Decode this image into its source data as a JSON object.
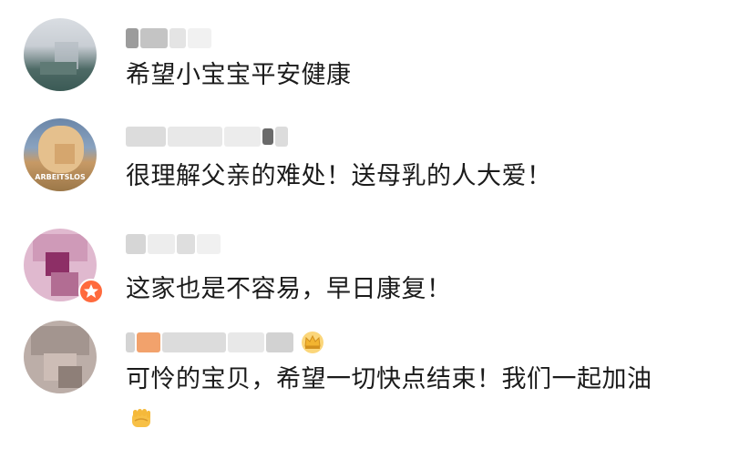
{
  "comments": [
    {
      "text": "希望小宝宝平安健康"
    },
    {
      "text": "很理解父亲的难处！送母乳的人大爱！",
      "avatar_caption": "ARBEITSLOS"
    },
    {
      "text": "这家也是不容易，早日康复！"
    },
    {
      "text": "可怜的宝贝，希望一切快点结束！我们一起加油",
      "emoji": "✊"
    }
  ],
  "icons": {
    "crown": "crown-icon",
    "star_badge": "star-badge-icon",
    "fist_emoji": "raised-fist-emoji"
  },
  "colors": {
    "text": "#1b1b1b",
    "crown_gold": "#f2b431",
    "badge_orange": "#ff6a3d"
  }
}
